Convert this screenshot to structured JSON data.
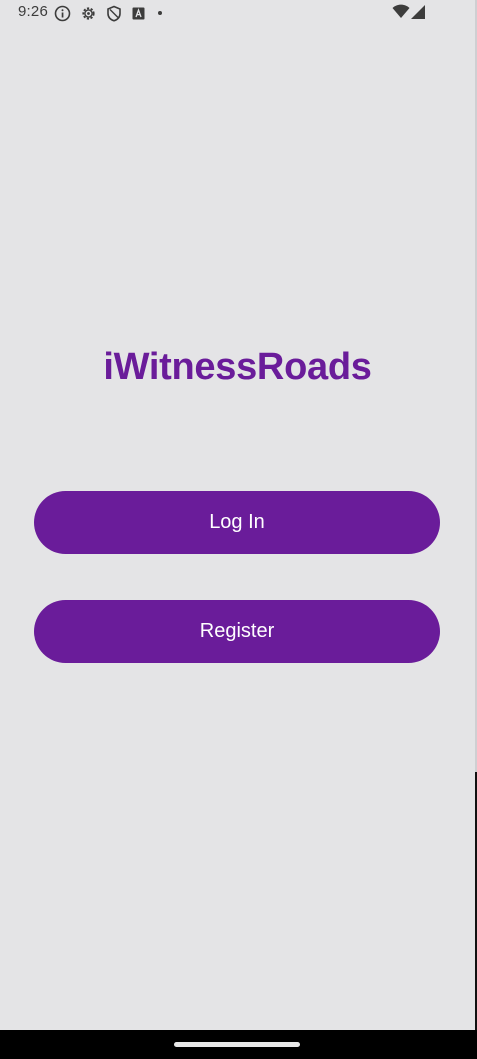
{
  "status_bar": {
    "time": "9:26",
    "left_icons": [
      "info-icon",
      "settings-gear-icon",
      "shield-icon",
      "a-square-icon",
      "dot-icon"
    ],
    "right_icons": [
      "wifi-icon",
      "signal-icon"
    ]
  },
  "app": {
    "title": "iWitnessRoads",
    "accent_color": "#6a1c9a",
    "background_color": "#e4e4e6"
  },
  "buttons": {
    "login_label": "Log In",
    "register_label": "Register"
  }
}
